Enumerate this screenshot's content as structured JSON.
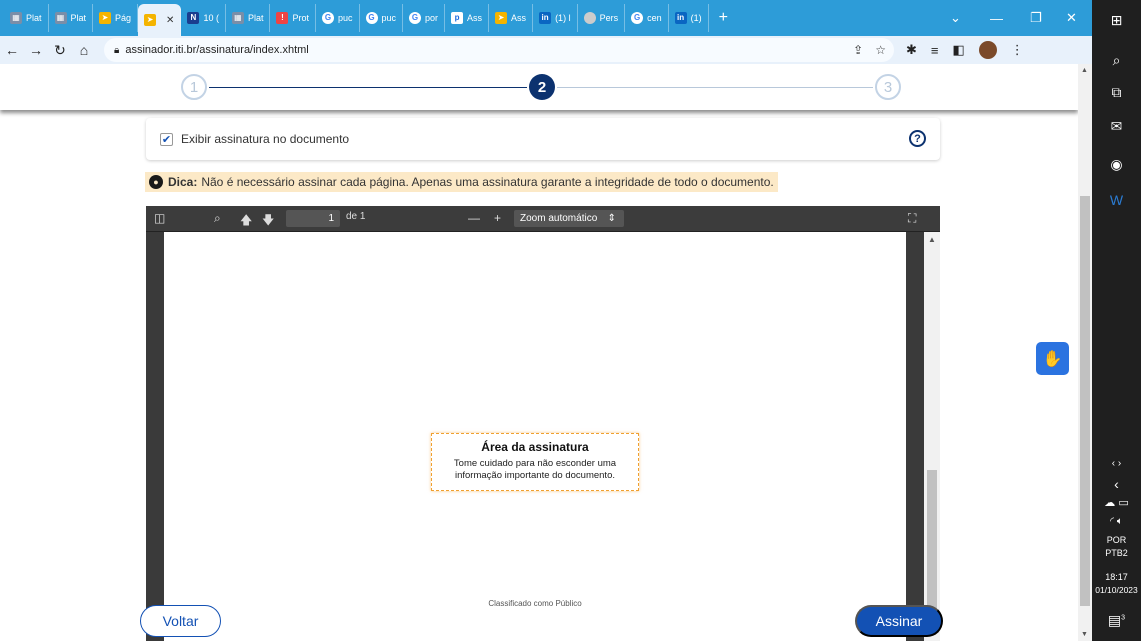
{
  "browser": {
    "tabs": [
      {
        "label": "Plat",
        "icon": "plat-favicon",
        "active": false
      },
      {
        "label": "Plat",
        "icon": "plat-favicon",
        "active": false
      },
      {
        "label": "Pág",
        "icon": "gov-favicon",
        "active": false
      },
      {
        "label": "",
        "icon": "gov-favicon",
        "active": true
      },
      {
        "label": "10 (",
        "icon": "nn-favicon",
        "active": false
      },
      {
        "label": "Plat",
        "icon": "plat-favicon",
        "active": false
      },
      {
        "label": "Prot",
        "icon": "prot-favicon",
        "active": false
      },
      {
        "label": "puc",
        "icon": "google-favicon",
        "active": false
      },
      {
        "label": "puc",
        "icon": "google-favicon",
        "active": false
      },
      {
        "label": "por",
        "icon": "google-favicon",
        "active": false
      },
      {
        "label": "Ass",
        "icon": "p-favicon",
        "active": false
      },
      {
        "label": "Ass",
        "icon": "gov-favicon",
        "active": false
      },
      {
        "label": "(1) l",
        "icon": "linkedin-favicon",
        "active": false
      },
      {
        "label": "Pers",
        "icon": "person-favicon",
        "active": false
      },
      {
        "label": "cen",
        "icon": "google-favicon",
        "active": false
      },
      {
        "label": "(1)",
        "icon": "linkedin-favicon",
        "active": false
      }
    ],
    "url": "assinador.iti.br/assinatura/index.xhtml"
  },
  "stepper": {
    "steps": [
      "1",
      "2",
      "3"
    ],
    "current": 2
  },
  "options": {
    "show_signature_label": "Exibir assinatura no documento",
    "show_signature_checked": true
  },
  "tip": {
    "bold": "Dica:",
    "text": "Não é necessário assinar cada página. Apenas uma assinatura garante a integridade de todo o documento."
  },
  "viewer": {
    "page_number": "1",
    "page_total": "de 1",
    "zoom": "Zoom automático",
    "zoom_out": "—",
    "zoom_in": "+",
    "signature_area": {
      "title": "Área da assinatura",
      "description": "Tome cuidado para não esconder uma informação importante do documento."
    },
    "footer_text": "Classificado como Público"
  },
  "actions": {
    "back_label": "Voltar",
    "sign_label": "Assinar"
  },
  "taskbar": {
    "lang": "POR",
    "layout": "PTB2",
    "time": "18:17",
    "date": "01/10/2023",
    "notification_count": "3"
  }
}
